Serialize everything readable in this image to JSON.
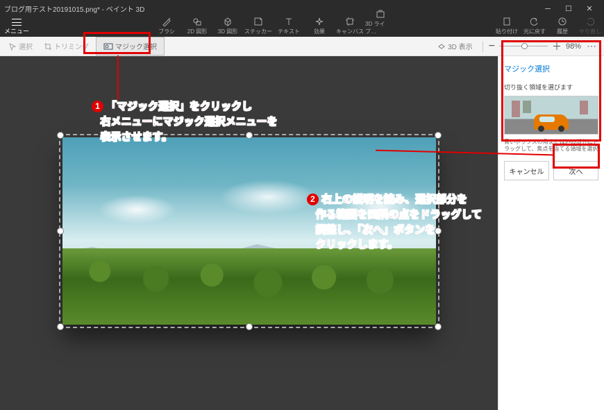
{
  "title": "ブログ用テスト20191015.png* - ペイント 3D",
  "menu": "メニュー",
  "ribbon": [
    {
      "label": "ブラシ"
    },
    {
      "label": "2D 図形"
    },
    {
      "label": "3D 図形"
    },
    {
      "label": "ステッカー"
    },
    {
      "label": "テキスト"
    },
    {
      "label": "効果"
    },
    {
      "label": "キャンバス"
    },
    {
      "label": "3D ライブ…"
    }
  ],
  "ribbon_right": [
    {
      "label": "貼り付け"
    },
    {
      "label": "元に戻す"
    },
    {
      "label": "履歴"
    },
    {
      "label": "やり直し"
    }
  ],
  "toolbar": {
    "select": "選択",
    "trim": "トリミング",
    "magic": "マジック選択",
    "view3d": "3D 表示",
    "zoom": "98%"
  },
  "right_panel": {
    "title": "マジック選択",
    "subtitle": "切り抜く領域を選びます",
    "desc": "青いボックスの角または辺の部分にドラッグして、焦点を当てる領域を選択してください",
    "cancel": "キャンセル",
    "next": "次へ"
  },
  "annotations": {
    "a1_l1": "「マジック選択」をクリックし",
    "a1_l2": "右メニューにマジック選択メニューを",
    "a1_l3": "表示させます。",
    "a2_l1": "右上の説明を読み、選択部分を",
    "a2_l2": "作る範囲を四隅の点をドラッグして",
    "a2_l3": "調整し、「次へ」ボタンを",
    "a2_l4": "クリックします。"
  }
}
